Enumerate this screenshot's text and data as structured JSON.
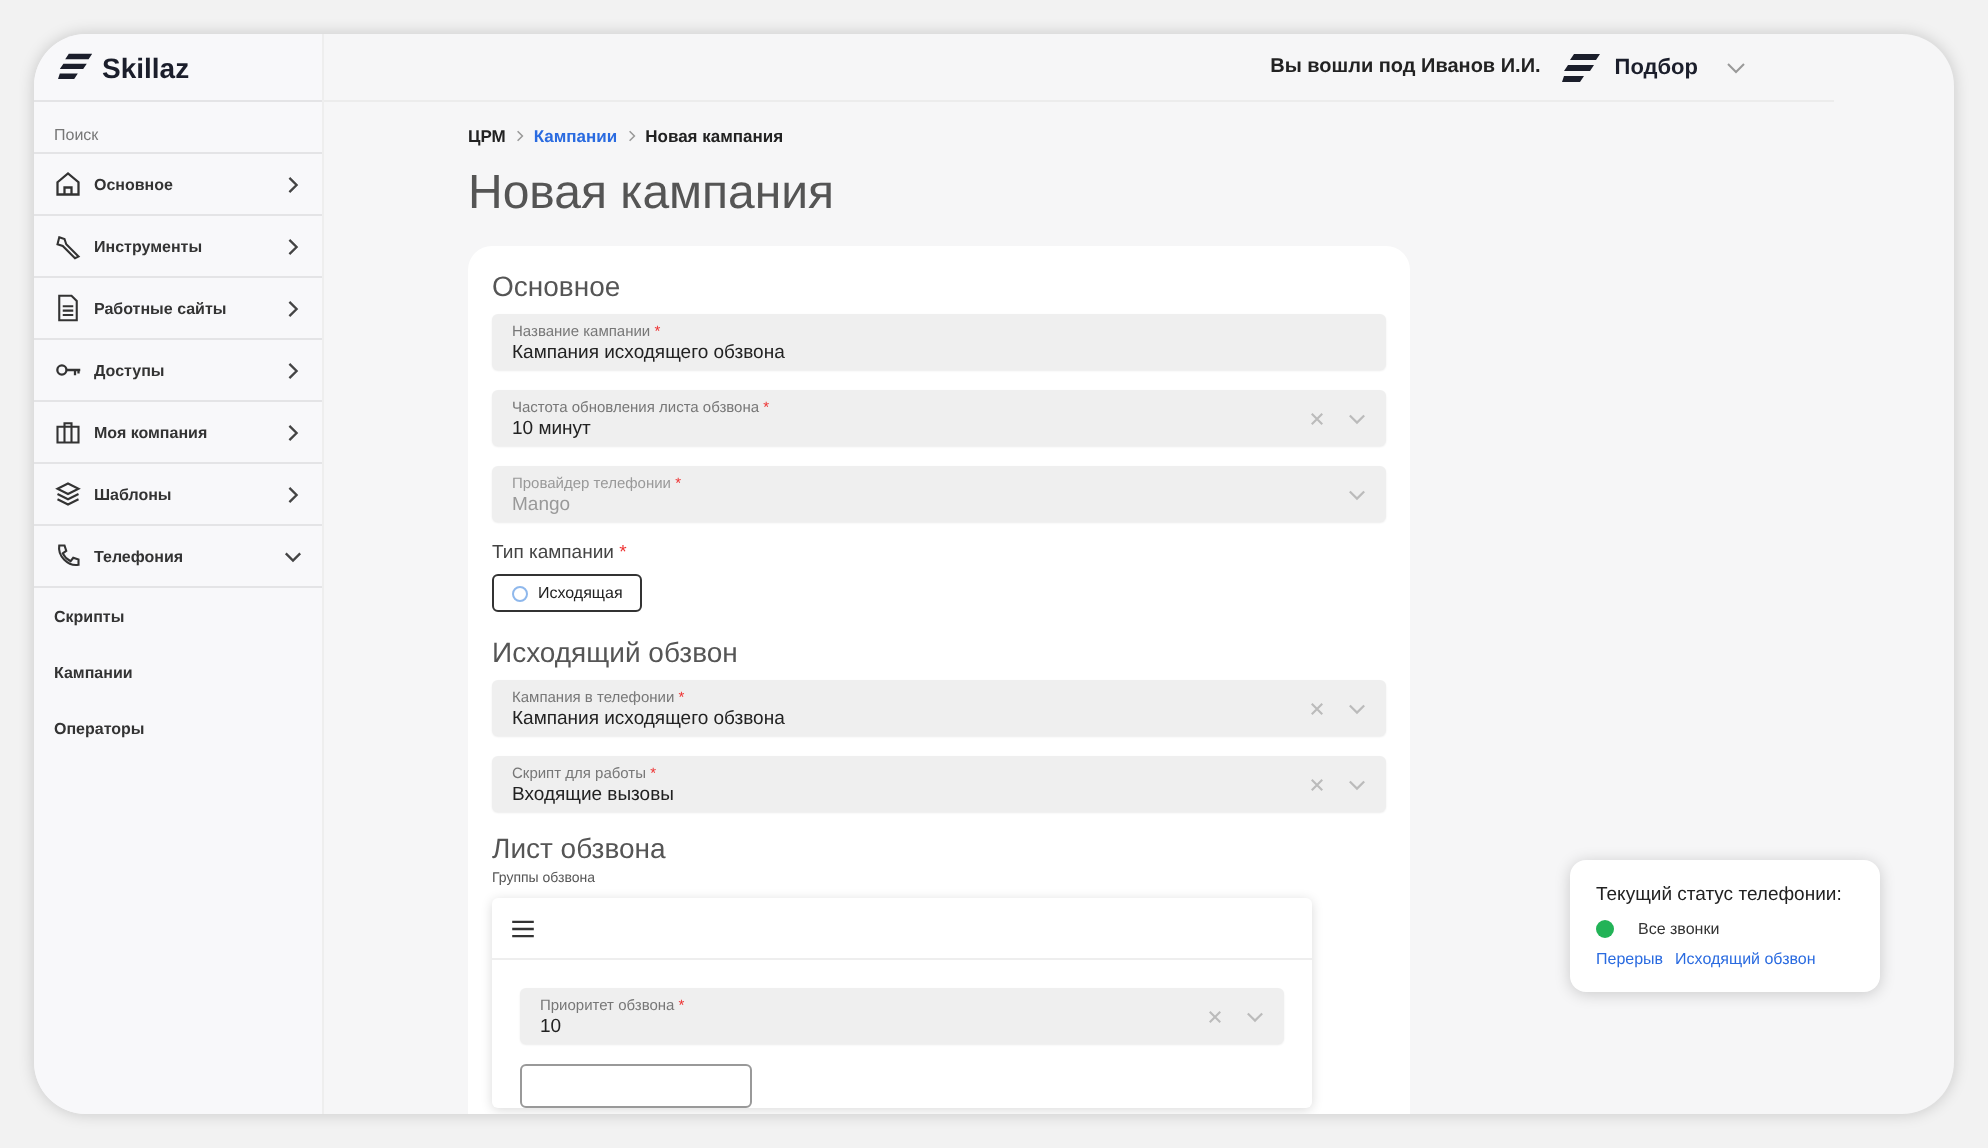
{
  "brand": {
    "name": "Skillaz"
  },
  "sidebar": {
    "search_label": "Поиск",
    "items": [
      {
        "label": "Основное",
        "expanded": false
      },
      {
        "label": "Инструменты",
        "expanded": false
      },
      {
        "label": "Работные сайты",
        "expanded": false
      },
      {
        "label": "Доступы",
        "expanded": false
      },
      {
        "label": "Моя компания",
        "expanded": false
      },
      {
        "label": "Шаблоны",
        "expanded": false
      },
      {
        "label": "Телефония",
        "expanded": true,
        "children": [
          {
            "label": "Скрипты"
          },
          {
            "label": "Кампании"
          },
          {
            "label": "Операторы"
          }
        ]
      }
    ]
  },
  "header": {
    "user_text": "Вы вошли под Иванов И.И.",
    "product": "Подбор"
  },
  "breadcrumbs": [
    {
      "label": "ЦРМ",
      "link": false
    },
    {
      "label": "Кампании",
      "link": true
    },
    {
      "label": "Новая кампания",
      "link": false
    }
  ],
  "page_title": "Новая кампания",
  "sections": [
    {
      "title": "Основное",
      "fields": [
        {
          "kind": "text",
          "label": "Название кампании",
          "required_mark": "*",
          "value": "Кампания исходящего обзвона",
          "clearable": false,
          "disabled": false
        },
        {
          "kind": "select",
          "label": "Частота обновления листа обзвона",
          "required_mark": "*",
          "value": "10 минут",
          "clearable": true,
          "disabled": false
        },
        {
          "kind": "select",
          "label": "Провайдер телефонии",
          "required_mark": "*",
          "value": "Mango",
          "clearable": false,
          "disabled": true
        },
        {
          "kind": "radio",
          "label": "Тип кампании",
          "required_mark": "*",
          "options": [
            {
              "label": "Исходящая",
              "selected": false
            }
          ]
        }
      ]
    },
    {
      "title": "Исходящий обзвон",
      "fields": [
        {
          "kind": "select",
          "label": "Кампания в телефонии",
          "required_mark": "*",
          "value": "Кампания исходящего обзвона",
          "clearable": true,
          "disabled": false
        },
        {
          "kind": "select",
          "label": "Скрипт для работы",
          "required_mark": "*",
          "value": "Входящие вызовы",
          "clearable": true,
          "disabled": false
        }
      ]
    },
    {
      "title": "Лист обзвона",
      "subtitle": "Группы обзвона",
      "group": {
        "fields": [
          {
            "kind": "select",
            "label": "Приоритет обзвона",
            "required_mark": "*",
            "value": "10",
            "clearable": true,
            "disabled": false
          }
        ]
      }
    }
  ],
  "status_popup": {
    "title": "Текущий статус телефонии:",
    "status": {
      "label": "Все звонки",
      "color": "#22b357"
    },
    "links": [
      "Перерыв",
      "Исходящий обзвон"
    ]
  }
}
